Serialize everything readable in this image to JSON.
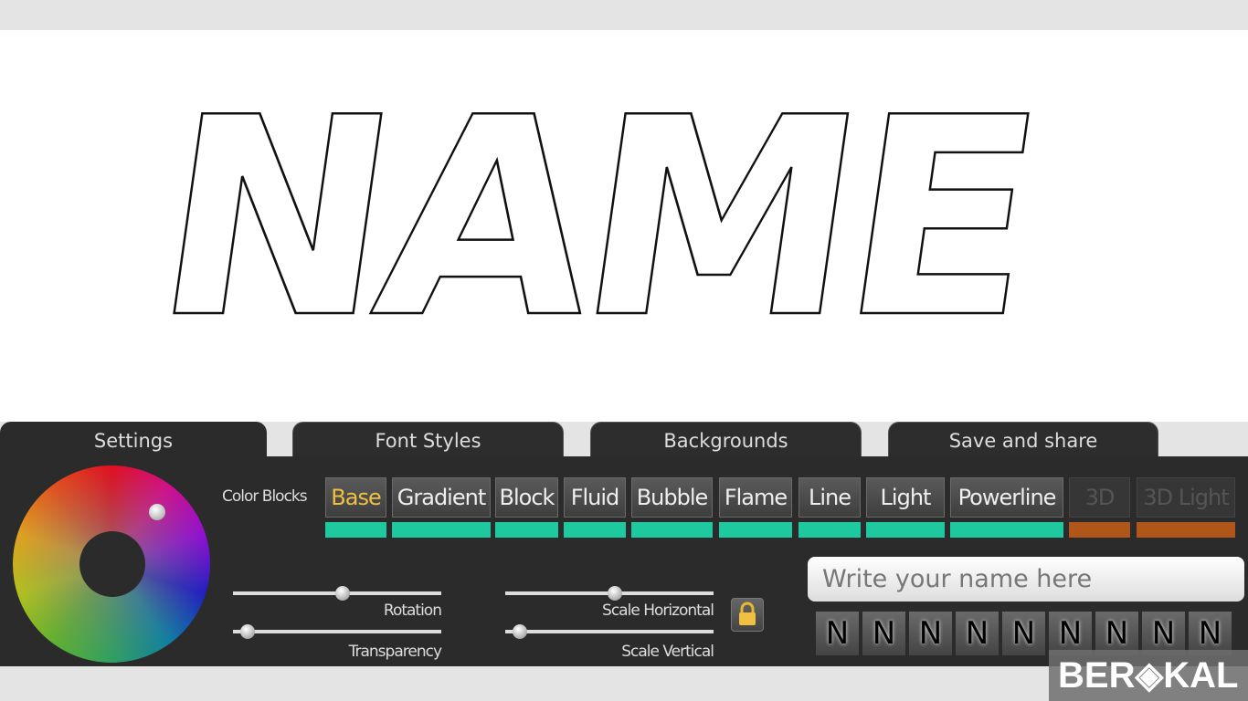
{
  "artwork": {
    "text": "NAME"
  },
  "tabs": [
    "Settings",
    "Font Styles",
    "Backgrounds",
    "Save and share"
  ],
  "color_blocks": {
    "label": "Color Blocks",
    "items": [
      {
        "label": "Base",
        "color": "#1fc9a0"
      },
      {
        "label": "Gradient",
        "color": "#1fc9a0"
      },
      {
        "label": "Block",
        "color": "#1fc9a0"
      },
      {
        "label": "Fluid",
        "color": "#1fc9a0"
      },
      {
        "label": "Bubble",
        "color": "#1fc9a0"
      },
      {
        "label": "Flame",
        "color": "#1fc9a0"
      },
      {
        "label": "Line",
        "color": "#1fc9a0"
      },
      {
        "label": "Light",
        "color": "#1fc9a0"
      },
      {
        "label": "Powerline",
        "color": "#1fc9a0"
      },
      {
        "label": "3D",
        "color": "#b0561a"
      },
      {
        "label": "3D Light",
        "color": "#b0561a"
      }
    ],
    "selected": "Base"
  },
  "sliders": {
    "rotation": {
      "label": "Rotation",
      "value": 0.53
    },
    "transparency": {
      "label": "Transparency",
      "value": 0.07
    },
    "scale_h": {
      "label": "Scale Horizontal",
      "value": 0.53
    },
    "scale_v": {
      "label": "Scale Vertical",
      "value": 0.07
    }
  },
  "name_input": {
    "placeholder": "Write your name here",
    "value": ""
  },
  "font_samples": [
    "N",
    "N",
    "N",
    "N",
    "N",
    "N",
    "N",
    "N",
    "N"
  ],
  "watermark": "BEROKAL"
}
